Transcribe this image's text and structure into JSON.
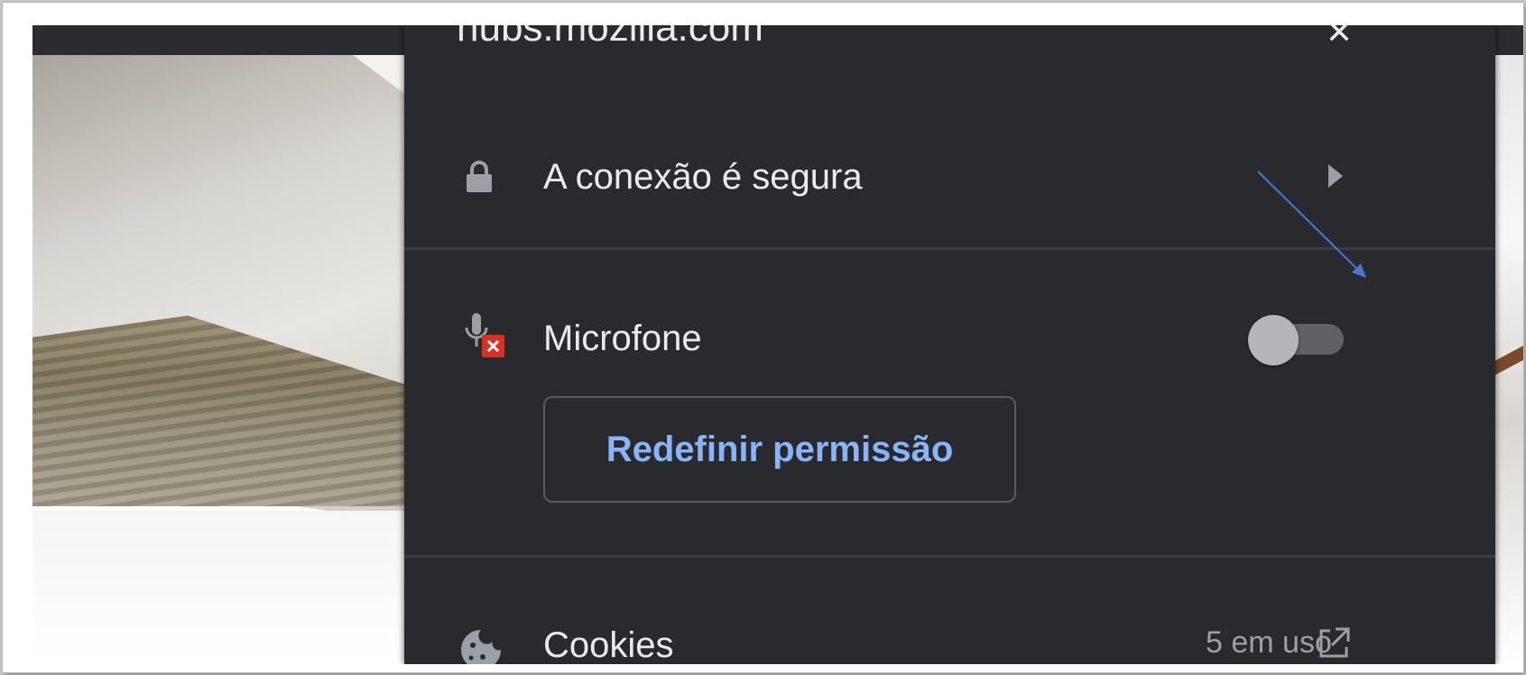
{
  "popup": {
    "site": "hubs.mozilla.com",
    "connection": {
      "label": "A conexão é segura"
    },
    "microphone": {
      "label": "Microfone",
      "enabled": false
    },
    "reset_button": "Redefinir permissão",
    "cookies": {
      "label": "Cookies",
      "count": "5 em uso"
    }
  },
  "icons": {
    "close": "close-icon",
    "connection": "lock-icon",
    "connection_chevron": "chevron-right-icon",
    "microphone": "mic-blocked-icon",
    "cookies": "cookie-icon",
    "cookies_link": "external-link-icon"
  },
  "colors": {
    "popup_bg": "#292a2d",
    "text": "#e8eaed",
    "link": "#8ab4f8",
    "blocked_badge": "#d93025",
    "annotation_arrow": "#4a78d0"
  }
}
